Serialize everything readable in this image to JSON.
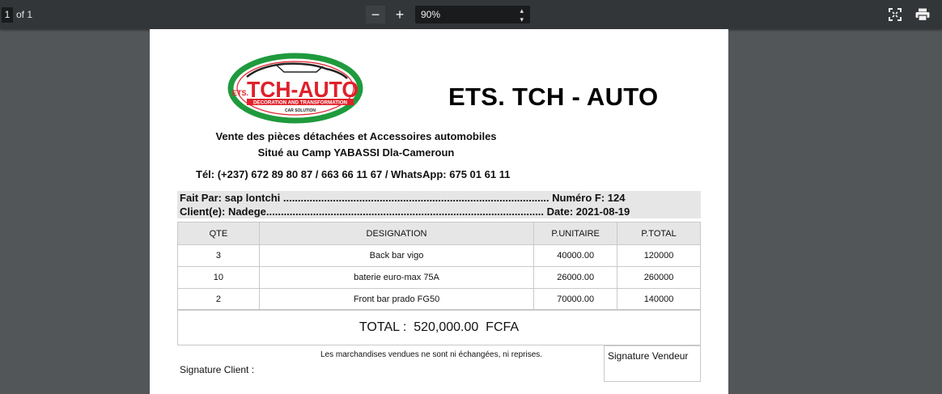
{
  "viewer": {
    "page_current": "1",
    "page_total": "of 1",
    "zoom_out": "−",
    "zoom_in": "+",
    "zoom_level": "90%",
    "zoom_arrows": "▴▾"
  },
  "document": {
    "logo_text": {
      "prefix": "ETS.",
      "name": "TCH-AUTO",
      "tagline": "DECORATION AND TRANSFORMATION",
      "sub": "CAR SOLUTION"
    },
    "company_name": "ETS. TCH - AUTO",
    "tagline_1": "Vente des pièces détachées et Accessoires automobiles",
    "tagline_2": "Situé au Camp YABASSI Dla-Cameroun",
    "telephone": "Tél: (+237) 672 89 80 87 / 663 66 11 67 / WhatsApp: 675 01 61 11",
    "fait_par_line": "Fait Par: sap lontchi ........................................................................................... Numéro F: 124",
    "client_line": "Client(e):  Nadege............................................................................................... Date: 2021-08-19",
    "table": {
      "headers": [
        "QTE",
        "DESIGNATION",
        "P.UNITAIRE",
        "P.TOTAL"
      ],
      "rows": [
        [
          "3",
          "Back bar vigo",
          "40000.00",
          "120000"
        ],
        [
          "10",
          "baterie euro-max 75A",
          "26000.00",
          "260000"
        ],
        [
          "2",
          "Front bar prado FG50",
          "70000.00",
          "140000"
        ]
      ]
    },
    "total": "TOTAL :  520,000.00  FCFA",
    "note": "Les marchandises vendues ne sont ni échangées, ni reprises.",
    "signature_client": "Signature Client :",
    "signature_vendor": "Signature Vendeur"
  },
  "colors": {
    "logo_green": "#1f9a3d",
    "logo_red": "#e0202a"
  }
}
